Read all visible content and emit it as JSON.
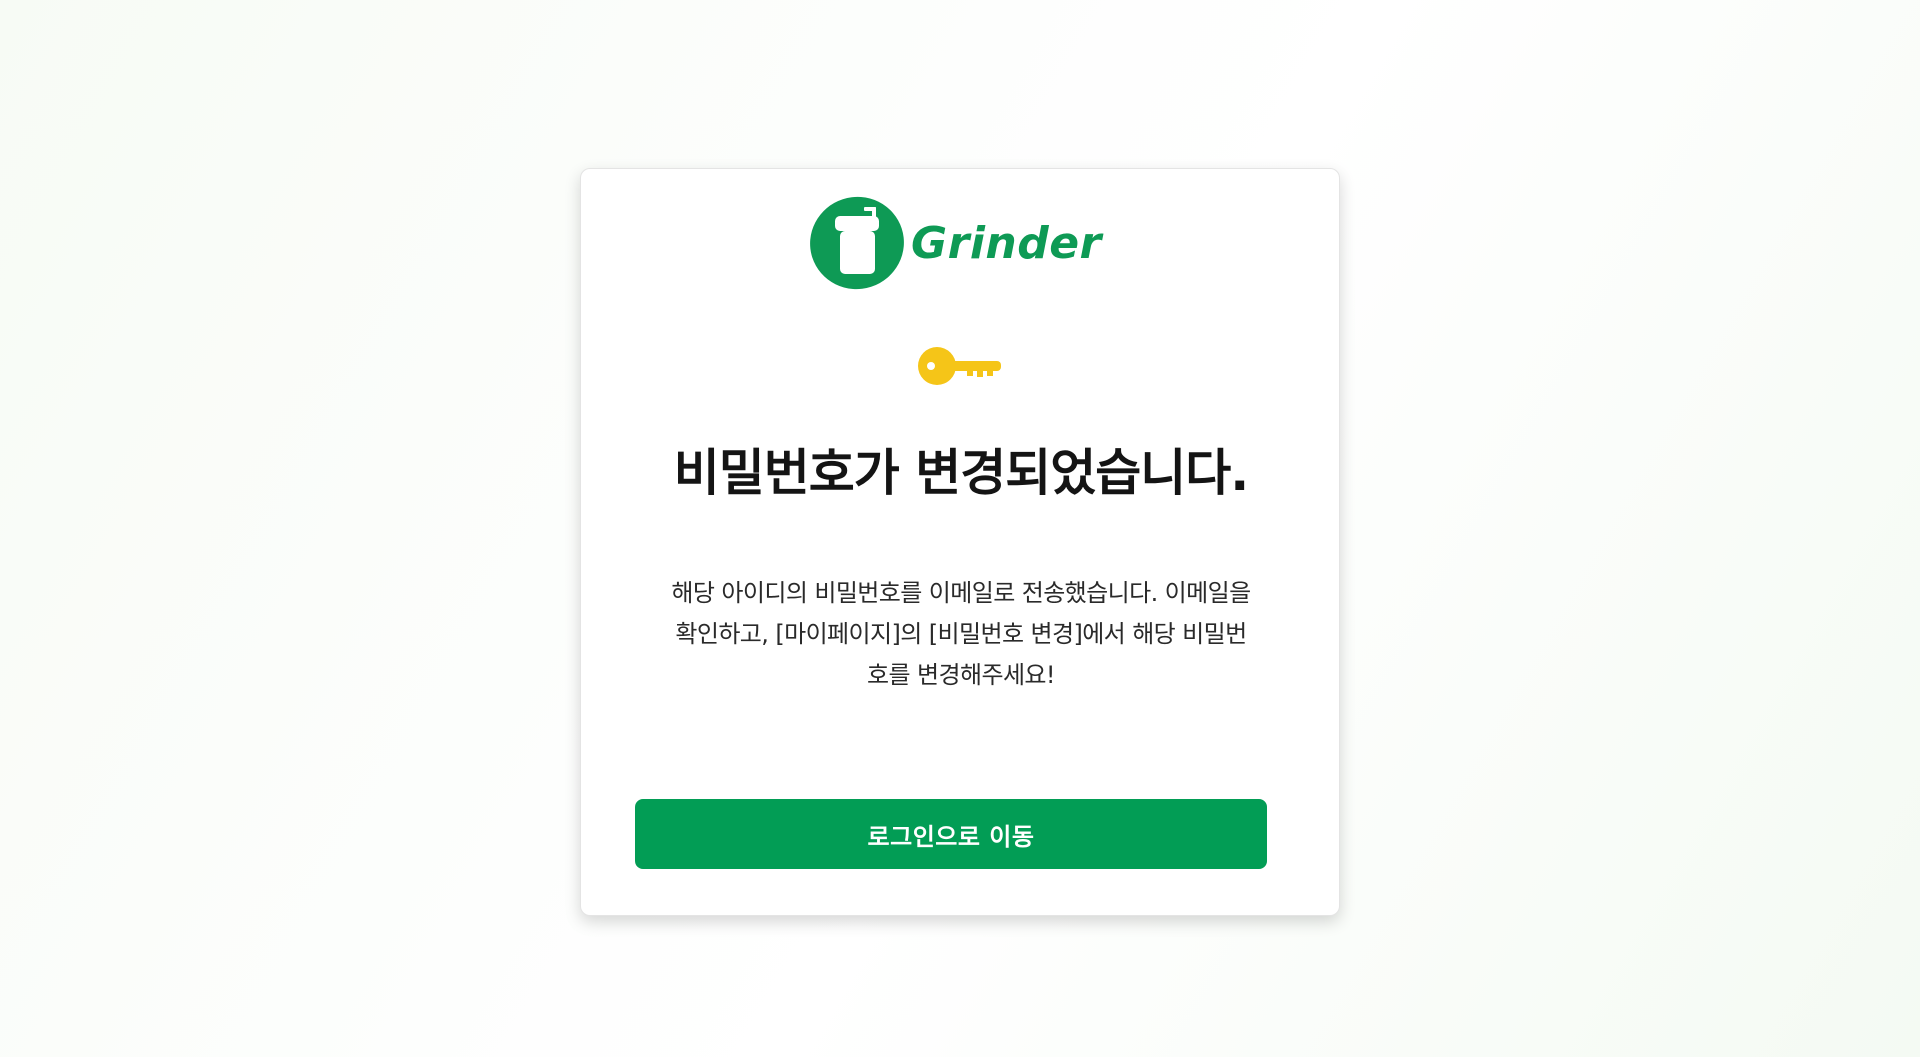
{
  "brand": {
    "name": "Grinder",
    "logo_icon": "coffee-grinder-icon",
    "color": "#0e9a55"
  },
  "status_icon": "key-icon",
  "colors": {
    "key": "#f5c518",
    "button": "#029d55"
  },
  "title": "비밀번호가 변경되었습니다.",
  "message": "해당 아이디의 비밀번호를 이메일로 전송했습니다. 이메일을 확인하고, [마이페이지]의 [비밀번호 변경]에서 해당 비밀번호를 변경해주세요!",
  "actions": {
    "login_label": "로그인으로 이동"
  }
}
